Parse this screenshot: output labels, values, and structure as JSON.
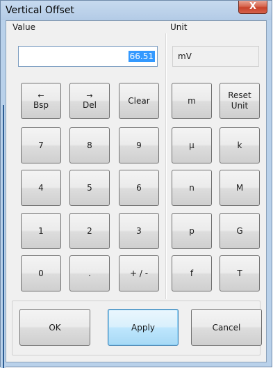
{
  "window": {
    "title": "Vertical Offset",
    "close_glyph": "X"
  },
  "value_section": {
    "label": "Value",
    "value": "66.51"
  },
  "unit_section": {
    "label": "Unit",
    "value": "mV"
  },
  "keypad": {
    "bsp_arrow": "←",
    "bsp_label": "Bsp",
    "del_arrow": "→",
    "del_label": "Del",
    "clear": "Clear",
    "k7": "7",
    "k8": "8",
    "k9": "9",
    "k4": "4",
    "k5": "5",
    "k6": "6",
    "k1": "1",
    "k2": "2",
    "k3": "3",
    "k0": "0",
    "dot": ".",
    "sign": "+ / -"
  },
  "unit_keys": {
    "m": "m",
    "reset_line1": "Reset",
    "reset_line2": "Unit",
    "micro": "μ",
    "k": "k",
    "n": "n",
    "M": "M",
    "p": "p",
    "G": "G",
    "f": "f",
    "T": "T"
  },
  "actions": {
    "ok": "OK",
    "apply": "Apply",
    "cancel": "Cancel"
  },
  "colors": {
    "frame": "#b9d1ea",
    "client_bg": "#f0f0f0",
    "selection": "#3399ff",
    "close_button": "#c8422a",
    "default_button": "#bee6fd"
  }
}
